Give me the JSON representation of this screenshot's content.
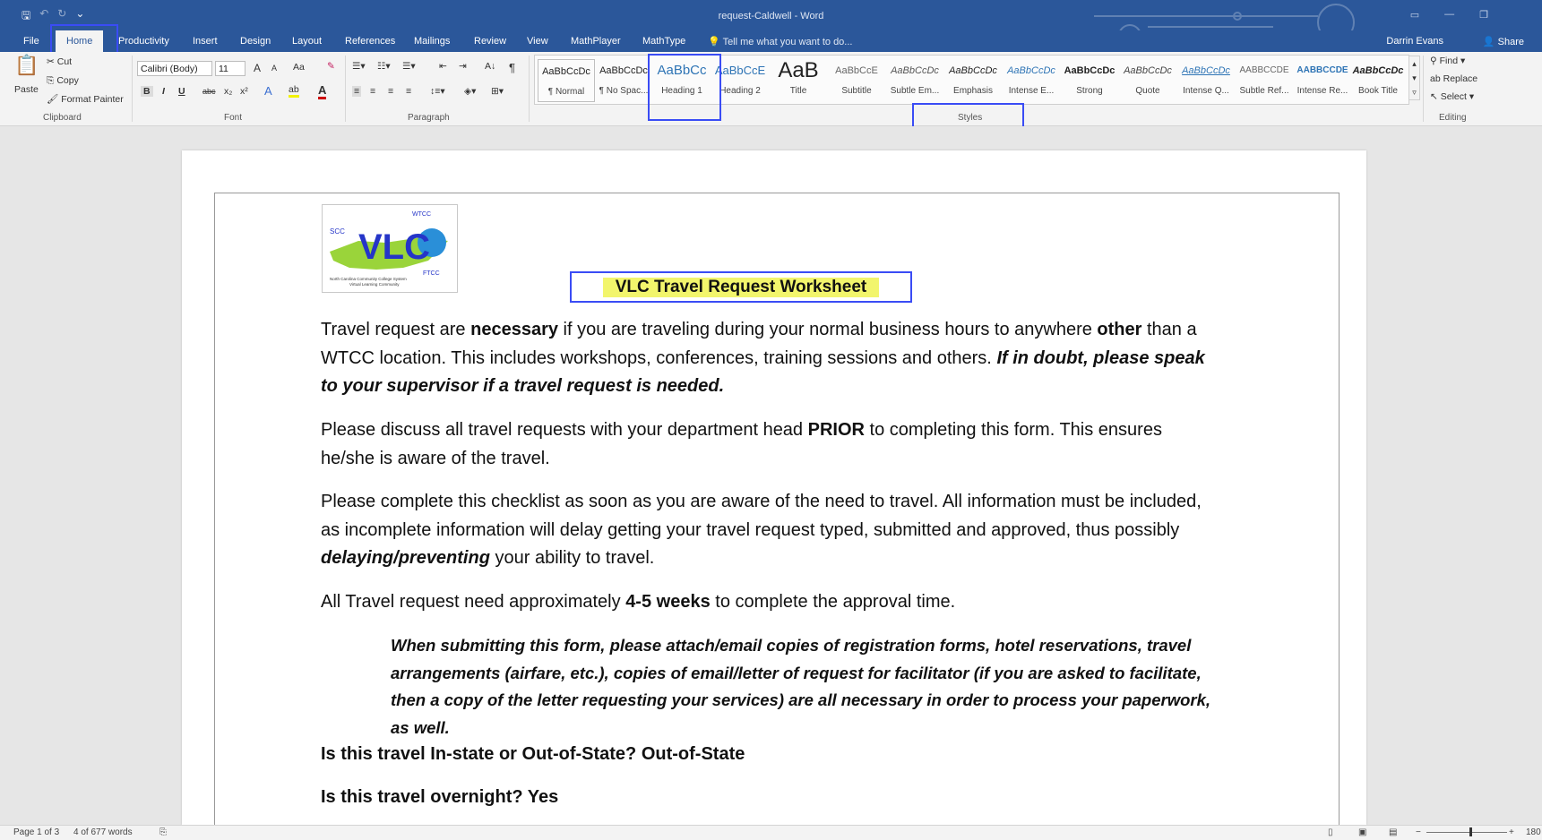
{
  "window": {
    "title": "request-Caldwell - Word"
  },
  "qat": {
    "save": "🖫",
    "undo": "↶",
    "redo": "↻",
    "more": "⌄"
  },
  "tabs": [
    {
      "label": "File"
    },
    {
      "label": "Home"
    },
    {
      "label": "Productivity"
    },
    {
      "label": "Insert"
    },
    {
      "label": "Design"
    },
    {
      "label": "Layout"
    },
    {
      "label": "References"
    },
    {
      "label": "Mailings"
    },
    {
      "label": "Review"
    },
    {
      "label": "View"
    },
    {
      "label": "MathPlayer"
    },
    {
      "label": "MathType"
    }
  ],
  "tellme": "Tell me what you want to do...",
  "user": "Darrin Evans",
  "share": "Share",
  "clipboard": {
    "paste": "Paste",
    "cut": "Cut",
    "copy": "Copy",
    "format_painter": "Format Painter",
    "label": "Clipboard"
  },
  "font": {
    "name": "Calibri (Body)",
    "size": "11",
    "grow": "A",
    "shrink": "A",
    "case": "Aa",
    "bold": "B",
    "italic": "I",
    "underline": "U",
    "strike": "abc",
    "sub": "x₂",
    "sup": "x²",
    "label": "Font"
  },
  "paragraph": {
    "label": "Paragraph",
    "pilcrow": "¶",
    "sort": "A↓"
  },
  "styles": {
    "label": "Styles",
    "items": [
      {
        "preview": "AaBbCcDc",
        "name": "¶ Normal"
      },
      {
        "preview": "AaBbCcDc",
        "name": "¶ No Spac..."
      },
      {
        "preview": "AaBbCc",
        "name": "Heading 1"
      },
      {
        "preview": "AaBbCcE",
        "name": "Heading 2"
      },
      {
        "preview": "AaB",
        "name": "Title"
      },
      {
        "preview": "AaBbCcE",
        "name": "Subtitle"
      },
      {
        "preview": "AaBbCcDc",
        "name": "Subtle Em..."
      },
      {
        "preview": "AaBbCcDc",
        "name": "Emphasis"
      },
      {
        "preview": "AaBbCcDc",
        "name": "Intense E..."
      },
      {
        "preview": "AaBbCcDc",
        "name": "Strong"
      },
      {
        "preview": "AaBbCcDc",
        "name": "Quote"
      },
      {
        "preview": "AaBbCcDc",
        "name": "Intense Q..."
      },
      {
        "preview": "AABBCCDE",
        "name": "Subtle Ref..."
      },
      {
        "preview": "AABBCCDE",
        "name": "Intense Re..."
      },
      {
        "preview": "AaBbCcDc",
        "name": "Book Title"
      }
    ]
  },
  "editing": {
    "find": "Find",
    "replace": "Replace",
    "select": "Select",
    "label": "Editing"
  },
  "document": {
    "logo": {
      "text": "VLC",
      "scc": "SCC",
      "wtcc": "WTCC",
      "ftcc": "FTCC",
      "caption1": "North Carolina Community College System",
      "caption2": "Virtual Learning Community"
    },
    "title": "VLC Travel Request Worksheet",
    "p1": {
      "a": "Travel request are ",
      "b": "necessary",
      "c": " if you are traveling during your normal business hours to anywhere ",
      "d": "other",
      "e": " than a WTCC location. This includes workshops, conferences, training sessions and others.  ",
      "f": "If in doubt, please speak to your supervisor if a travel request is needed."
    },
    "p2": {
      "a": "Please discuss all travel requests with your department head ",
      "b": "PRIOR",
      "c": " to completing this form. This ensures he/she is aware of the travel."
    },
    "p3": {
      "a": "Please complete this checklist as soon as you are aware of the need to travel. All information must be included, as incomplete information will delay getting your travel request typed, submitted and approved, thus possibly ",
      "b": "delaying/preventing",
      "c": " your ability to travel."
    },
    "p4": {
      "a": "All Travel request need approximately ",
      "b": "4-5 weeks",
      "c": " to complete the approval time."
    },
    "p5": "When submitting this form, please attach/email copies of registration forms, hotel reservations, travel arrangements (airfare, etc.), copies of email/letter of request for facilitator (if you are asked to facilitate, then a copy of the letter requesting your services) are all necessary in order to process your paperwork, as well.",
    "q1": "Is this travel In-state or Out-of-State? Out-of-State",
    "q2": "Is this travel overnight? Yes"
  },
  "status": {
    "page": "Page 1 of 3",
    "words": "4 of 677 words",
    "zoom": "180"
  },
  "colors": {
    "ribbon_blue": "#2b579a",
    "highlight_box": "#3a4cf5",
    "title_highlight": "#f2f56c"
  }
}
